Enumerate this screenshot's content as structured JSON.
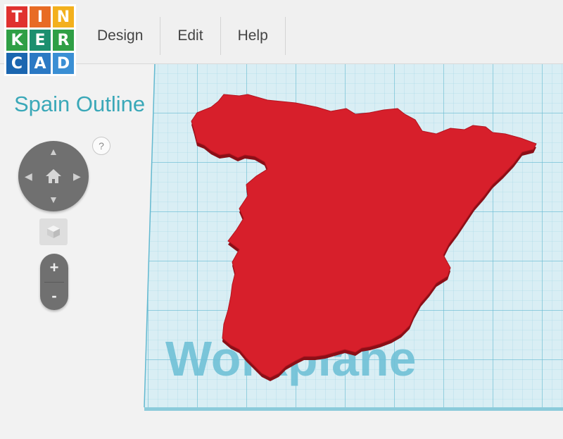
{
  "app": {
    "logo_letters": [
      "T",
      "I",
      "N",
      "K",
      "E",
      "R",
      "C",
      "A",
      "D"
    ],
    "logo_colors": [
      "#e0312f",
      "#e86b24",
      "#f3b01d",
      "#2f9f45",
      "#1c8f6f",
      "#2f9f45",
      "#1b66b0",
      "#2b79c4",
      "#3a8fd4"
    ]
  },
  "menu": {
    "items": [
      "Design",
      "Edit",
      "Help"
    ]
  },
  "design": {
    "title": "Spain Outline"
  },
  "controls": {
    "help_label": "?",
    "zoom_in_label": "+",
    "zoom_out_label": "-",
    "icons": [
      "question-icon",
      "arrow-up-icon",
      "arrow-down-icon",
      "arrow-left-icon",
      "arrow-right-icon",
      "home-icon",
      "cube-icon",
      "plus-icon",
      "minus-icon"
    ]
  },
  "workplane": {
    "label": "Workplane",
    "grid_color": "#7fc9db",
    "plane_color": "#d7eef5",
    "shape_color": "#d71f2b",
    "shape_name": "Spain"
  }
}
